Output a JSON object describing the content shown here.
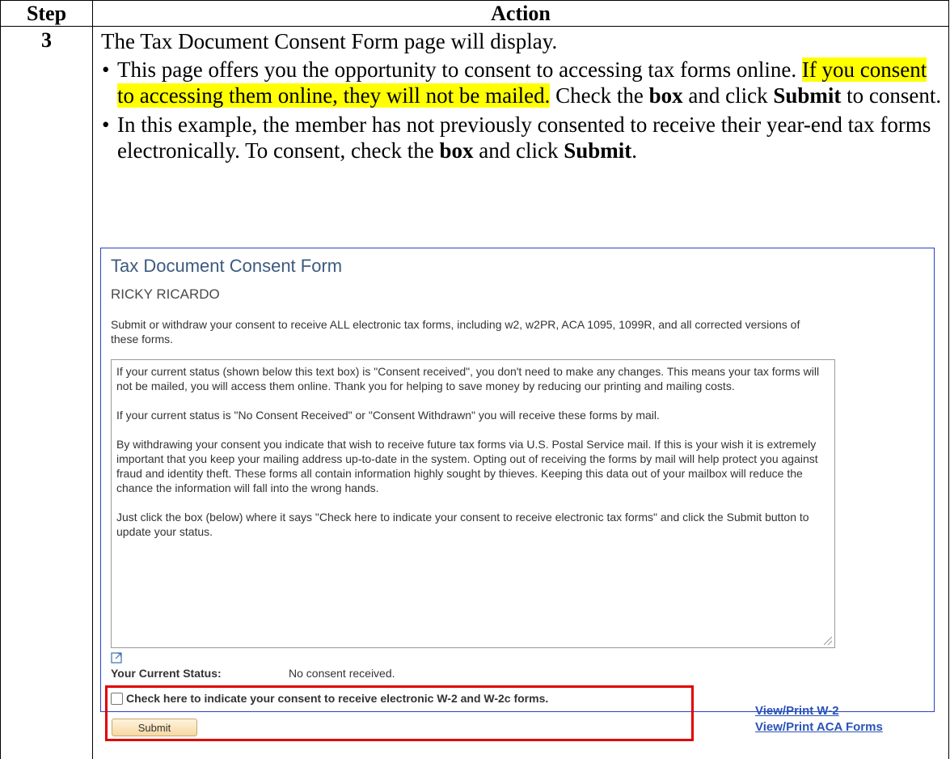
{
  "table": {
    "header_step": "Step",
    "header_action": "Action",
    "step_number": "3",
    "intro": "The Tax Document Consent Form page will display.",
    "bullet1": {
      "text_a": "This page offers you the opportunity to consent to accessing tax forms online.",
      "highlight": "If you consent to accessing them online, they will not be mailed.",
      "text_b": " Check the ",
      "bold1": "box",
      "text_c": " and click ",
      "bold2": "Submit",
      "text_d": " to consent."
    },
    "bullet2": {
      "text_a": "In this example, the member has not previously consented to receive their year-end tax forms electronically. To consent, check the ",
      "bold1": "box",
      "text_b": " and click ",
      "bold2": "Submit",
      "text_c": "."
    }
  },
  "form": {
    "title": "Tax Document Consent Form",
    "member_name": "RICKY RICARDO",
    "description": "Submit or withdraw your consent to receive ALL electronic tax forms, including w2, w2PR, ACA 1095, 1099R, and all corrected versions of these forms.",
    "consent_text": {
      "p1": "If your current status (shown below this text box) is \"Consent received\", you don't need to make any changes. This means your tax forms will not be mailed, you will access them online. Thank you for helping to save money by reducing our printing and mailing costs.",
      "p2": "If your current status is \"No Consent Received\" or  \"Consent Withdrawn\" you will  receive these forms by mail.",
      "p3": "By withdrawing your consent you indicate that wish to receive future tax forms via U.S. Postal Service mail. If this is your wish it is extremely important that you keep your mailing address up-to-date in the system. Opting out of receiving the forms by mail will help protect you against fraud and identity theft. These forms all contain information highly sought by thieves. Keeping this data out of your mailbox will reduce the chance the information will fall into the wrong hands.",
      "p4": "Just click the box (below) where it says \"Check here to indicate your consent to receive electronic tax forms\" and click the Submit button to update your status."
    },
    "status_label": "Your Current Status:",
    "status_value": "No consent received.",
    "checkbox_label": "Check here to indicate your consent to receive electronic W-2 and W-2c forms.",
    "checkbox_checked": false,
    "submit_label": "Submit",
    "link_w2": "View/Print W-2",
    "link_aca": "View/Print ACA Forms",
    "icons": [
      "expand-icon",
      "resize-grip-icon"
    ],
    "colors": {
      "title": "#3d5a80",
      "link": "#2a53b8",
      "highlight": "#ffff00",
      "callout_border": "#e00000",
      "screenshot_border": "#2b40c4"
    }
  }
}
